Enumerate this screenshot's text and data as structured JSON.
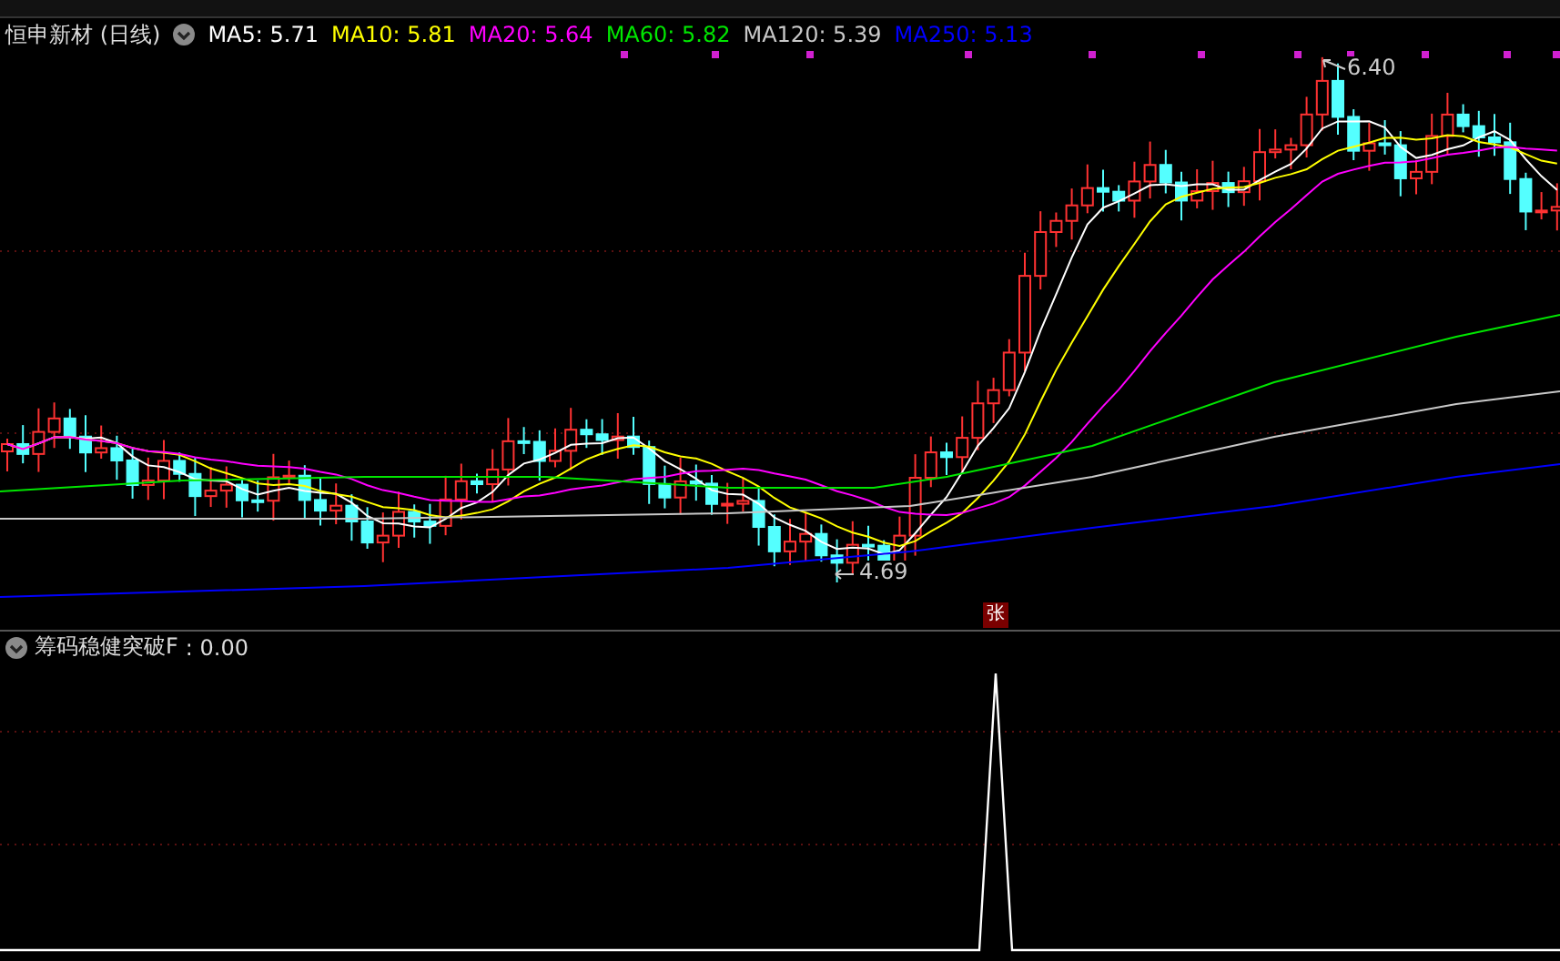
{
  "stock": {
    "title": "恒申新材 (日线)"
  },
  "moving_averages": [
    {
      "label": "MA5: 5.71",
      "color": "#ffffff"
    },
    {
      "label": "MA10: 5.81",
      "color": "#ffff00"
    },
    {
      "label": "MA20: 5.64",
      "color": "#ff00ff"
    },
    {
      "label": "MA60: 5.82",
      "color": "#00e600"
    },
    {
      "label": "MA120: 5.39",
      "color": "#c8c8c8"
    },
    {
      "label": "MA250: 5.13",
      "color": "#0000ff"
    }
  ],
  "price_labels": {
    "high": "6.40",
    "low": "4.69"
  },
  "badge": "张",
  "indicator": {
    "name": "筹码稳健突破F",
    "value": ": 0.00"
  }
}
